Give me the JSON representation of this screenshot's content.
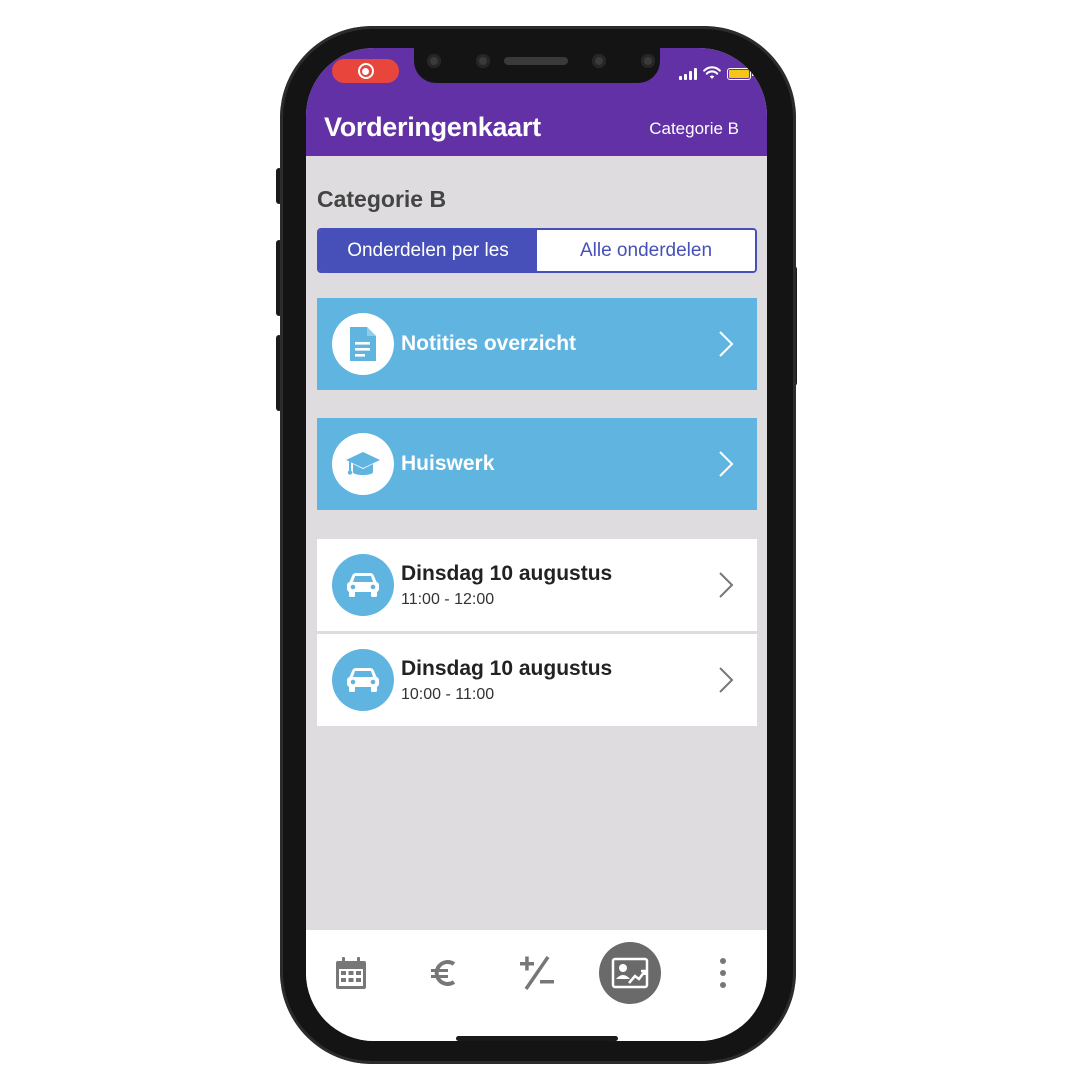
{
  "status_bar": {
    "recording_icon": "record-icon",
    "signal_icon": "signal-icon",
    "wifi_icon": "wifi-icon",
    "battery_icon": "battery-icon",
    "battery_color": "#f5c518",
    "recording_color": "#e8453c"
  },
  "header": {
    "title": "Vorderingenkaart",
    "category": "Categorie B",
    "background": "#6231a5"
  },
  "page": {
    "section_title": "Categorie B",
    "segmented": {
      "options": [
        "Onderdelen per les",
        "Alle onderdelen"
      ],
      "selected": "Onderdelen per les"
    }
  },
  "menu_cards": [
    {
      "label": "Notities overzicht",
      "icon": "document-icon"
    },
    {
      "label": "Huiswerk",
      "icon": "graduation-cap-icon"
    }
  ],
  "lessons": [
    {
      "date": "Dinsdag 10 augustus",
      "time": "11:00 - 12:00",
      "icon": "car-icon"
    },
    {
      "date": "Dinsdag 10 augustus",
      "time": "10:00 - 11:00",
      "icon": "car-icon"
    }
  ],
  "tab_bar": {
    "items": [
      {
        "icon": "calendar-icon",
        "active": false
      },
      {
        "icon": "euro-icon",
        "active": false
      },
      {
        "icon": "plus-minus-icon",
        "active": false
      },
      {
        "icon": "progress-card-icon",
        "active": true
      },
      {
        "icon": "more-vertical-icon",
        "active": false
      }
    ]
  },
  "colors": {
    "accent": "#4650b8",
    "card_blue": "#5fb4e0",
    "content_bg": "#dedcdf"
  }
}
